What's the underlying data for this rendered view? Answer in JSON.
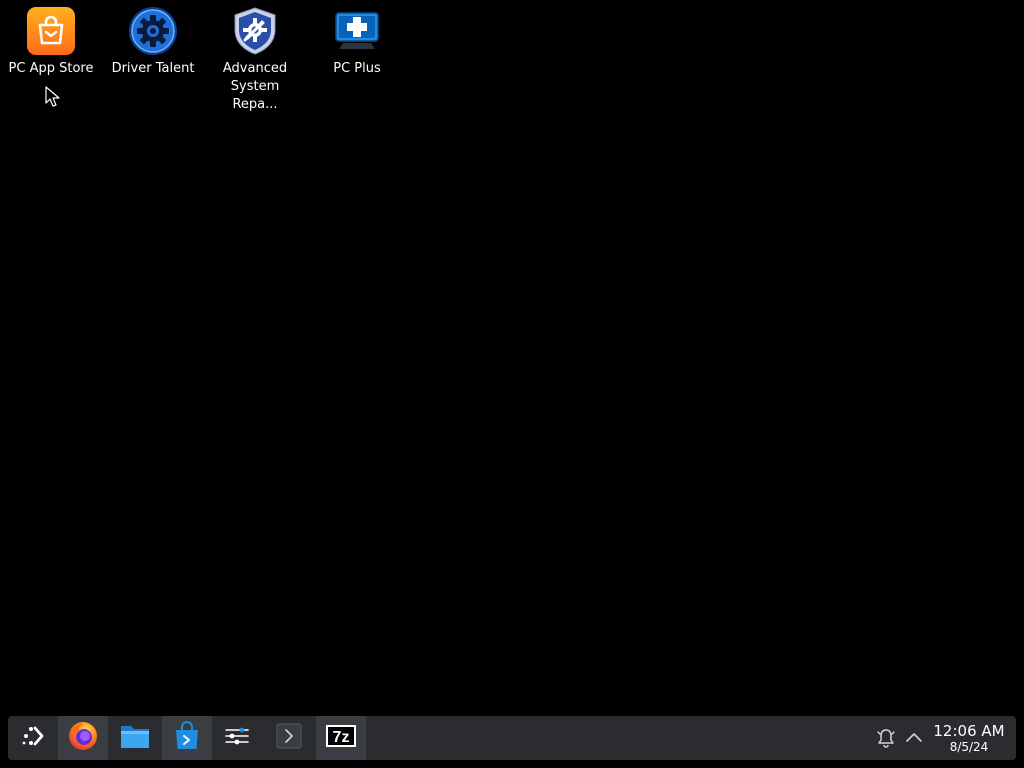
{
  "desktop": {
    "background_color": "#000000",
    "icons": [
      {
        "label": "PC App Store",
        "icon": "shopping-bag-icon",
        "color": "#ff8a1e"
      },
      {
        "label": "Driver Talent",
        "icon": "gear-icon",
        "color": "#1e6fd9"
      },
      {
        "label": "Advanced\nSystem Repa...",
        "icon": "shield-icon",
        "color": "#2a4fa8"
      },
      {
        "label": "PC Plus",
        "icon": "medical-cross-monitor-icon",
        "color": "#1e8fe0"
      }
    ]
  },
  "taskbar": {
    "background_color": "#2a2c30",
    "launcher": {
      "icon": "app-launcher-icon"
    },
    "pinned": [
      {
        "name": "Firefox",
        "icon": "firefox-icon",
        "active": true
      },
      {
        "name": "Files",
        "icon": "folder-icon",
        "active": false
      },
      {
        "name": "Store",
        "icon": "store-bag-icon",
        "active": true
      },
      {
        "name": "Settings",
        "icon": "settings-sliders-icon",
        "active": false
      },
      {
        "name": "Terminal",
        "icon": "terminal-icon",
        "active": false
      },
      {
        "name": "7-Zip",
        "icon": "sevenzip-icon",
        "active": true,
        "text": "7z"
      }
    ],
    "tray": {
      "notifications_icon": "bell-icon",
      "expand_icon": "chevron-up-icon",
      "clock": {
        "time": "12:06 AM",
        "date": "8/5/24"
      }
    }
  }
}
